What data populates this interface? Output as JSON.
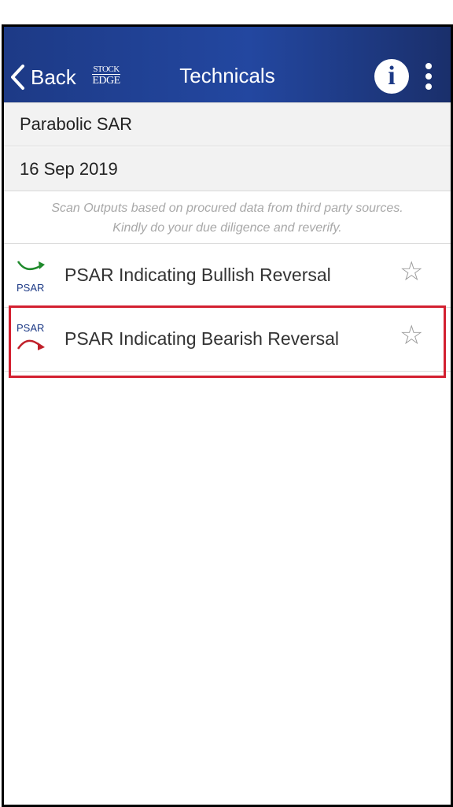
{
  "header": {
    "back_label": "Back",
    "logo_line1": "STOCK",
    "logo_line2": "EDGE",
    "title": "Technicals",
    "info_glyph": "i",
    "bar_color": "#2347a0"
  },
  "section": {
    "indicator": "Parabolic SAR",
    "date": "16 Sep 2019"
  },
  "disclaimer": {
    "line1": "Scan Outputs based on procured data from third party sources.",
    "line2": "Kindly do your due diligence and reverify."
  },
  "scans": [
    {
      "label": "PSAR Indicating Bullish Reversal",
      "icon_text": "PSAR",
      "icon": "psar-bullish-icon",
      "arrow_color": "#1f8a2c",
      "starred": false
    },
    {
      "label": "PSAR Indicating Bearish Reversal",
      "icon_text": "PSAR",
      "icon": "psar-bearish-icon",
      "arrow_color": "#c0202a",
      "starred": false
    }
  ],
  "star_glyph": "☆",
  "highlight_color": "#d32030"
}
